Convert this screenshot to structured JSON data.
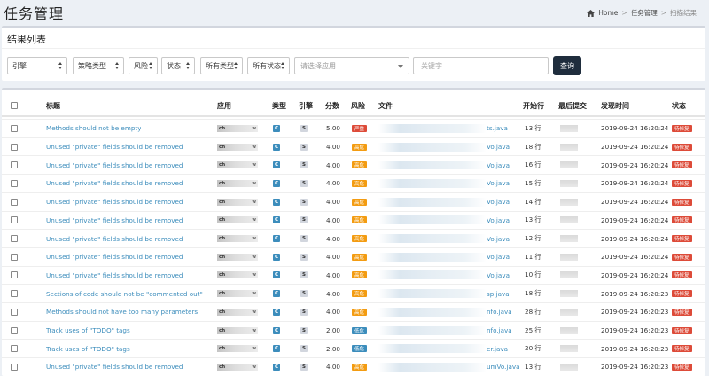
{
  "header": {
    "title": "任务管理",
    "breadcrumb": [
      "Home",
      "任务管理",
      "扫描结果"
    ]
  },
  "filters": {
    "box_title": "结果列表",
    "selects": [
      {
        "name": "engine",
        "value": "引擎"
      },
      {
        "name": "policy-type",
        "value": "策略类型"
      },
      {
        "name": "risk",
        "value": "风险"
      },
      {
        "name": "status",
        "value": "状态"
      },
      {
        "name": "all-types",
        "value": "所有类型"
      },
      {
        "name": "all-statuses",
        "value": "所有状态"
      }
    ],
    "app_placeholder": "请选择应用",
    "keyword_placeholder": "关键字",
    "search_label": "查询"
  },
  "table": {
    "columns": [
      "标题",
      "应用",
      "类型",
      "引擎",
      "分数",
      "风险",
      "文件",
      "开始行",
      "最后提交",
      "发现时间",
      "状态"
    ],
    "rows": [
      {
        "title": "Methods should not be empty",
        "app": "ch",
        "app_tail": "w",
        "type": "C",
        "engine": "S",
        "score": "5.00",
        "risk": "严重",
        "risk_level": "severe",
        "file": "ts.java",
        "line": "13 行",
        "time": "2019-09-24 16:20:24",
        "status": "待修复"
      },
      {
        "title": "Unused \"private\" fields should be removed",
        "app": "ch",
        "app_tail": "w",
        "type": "C",
        "engine": "S",
        "score": "4.00",
        "risk": "高危",
        "risk_level": "high",
        "file": "Vo.java",
        "line": "18 行",
        "time": "2019-09-24 16:20:24",
        "status": "待修复"
      },
      {
        "title": "Unused \"private\" fields should be removed",
        "app": "ch",
        "app_tail": "w",
        "type": "C",
        "engine": "S",
        "score": "4.00",
        "risk": "高危",
        "risk_level": "high",
        "file": "Vo.java",
        "line": "16 行",
        "time": "2019-09-24 16:20:24",
        "status": "待修复"
      },
      {
        "title": "Unused \"private\" fields should be removed",
        "app": "ch",
        "app_tail": "w",
        "type": "C",
        "engine": "S",
        "score": "4.00",
        "risk": "高危",
        "risk_level": "high",
        "file": "Vo.java",
        "line": "15 行",
        "time": "2019-09-24 16:20:24",
        "status": "待修复"
      },
      {
        "title": "Unused \"private\" fields should be removed",
        "app": "ch",
        "app_tail": "w",
        "type": "C",
        "engine": "S",
        "score": "4.00",
        "risk": "高危",
        "risk_level": "high",
        "file": "Vo.java",
        "line": "14 行",
        "time": "2019-09-24 16:20:24",
        "status": "待修复"
      },
      {
        "title": "Unused \"private\" fields should be removed",
        "app": "ch",
        "app_tail": "w",
        "type": "C",
        "engine": "S",
        "score": "4.00",
        "risk": "高危",
        "risk_level": "high",
        "file": "Vo.java",
        "line": "13 行",
        "time": "2019-09-24 16:20:24",
        "status": "待修复"
      },
      {
        "title": "Unused \"private\" fields should be removed",
        "app": "ch",
        "app_tail": "w",
        "type": "C",
        "engine": "S",
        "score": "4.00",
        "risk": "高危",
        "risk_level": "high",
        "file": "Vo.java",
        "line": "12 行",
        "time": "2019-09-24 16:20:24",
        "status": "待修复"
      },
      {
        "title": "Unused \"private\" fields should be removed",
        "app": "ch",
        "app_tail": "w",
        "type": "C",
        "engine": "S",
        "score": "4.00",
        "risk": "高危",
        "risk_level": "high",
        "file": "Vo.java",
        "line": "11 行",
        "time": "2019-09-24 16:20:24",
        "status": "待修复"
      },
      {
        "title": "Unused \"private\" fields should be removed",
        "app": "ch",
        "app_tail": "w",
        "type": "C",
        "engine": "S",
        "score": "4.00",
        "risk": "高危",
        "risk_level": "high",
        "file": "Vo.java",
        "line": "10 行",
        "time": "2019-09-24 16:20:24",
        "status": "待修复"
      },
      {
        "title": "Sections of code should not be \"commented out\"",
        "app": "ch",
        "app_tail": "w",
        "type": "C",
        "engine": "S",
        "score": "4.00",
        "risk": "高危",
        "risk_level": "high",
        "file": "sp.java",
        "line": "18 行",
        "time": "2019-09-24 16:20:23",
        "status": "待修复"
      },
      {
        "title": "Methods should not have too many parameters",
        "app": "ch",
        "app_tail": "w",
        "type": "C",
        "engine": "S",
        "score": "4.00",
        "risk": "高危",
        "risk_level": "high",
        "file": "nfo.java",
        "line": "28 行",
        "time": "2019-09-24 16:20:23",
        "status": "待修复"
      },
      {
        "title": "Track uses of \"TODO\" tags",
        "app": "ch",
        "app_tail": "w",
        "type": "C",
        "engine": "S",
        "score": "2.00",
        "risk": "低危",
        "risk_level": "low",
        "file": "nfo.java",
        "line": "25 行",
        "time": "2019-09-24 16:20:23",
        "status": "待修复"
      },
      {
        "title": "Track uses of \"TODO\" tags",
        "app": "ch",
        "app_tail": "w",
        "type": "C",
        "engine": "S",
        "score": "2.00",
        "risk": "低危",
        "risk_level": "low",
        "file": "er.java",
        "line": "20 行",
        "time": "2019-09-24 16:20:23",
        "status": "待修复"
      },
      {
        "title": "Unused \"private\" fields should be removed",
        "app": "ch",
        "app_tail": "w",
        "type": "C",
        "engine": "S",
        "score": "4.00",
        "risk": "高危",
        "risk_level": "high",
        "file": "umVo.java",
        "line": "13 行",
        "time": "2019-09-24 16:20:23",
        "status": "待修复"
      }
    ]
  }
}
